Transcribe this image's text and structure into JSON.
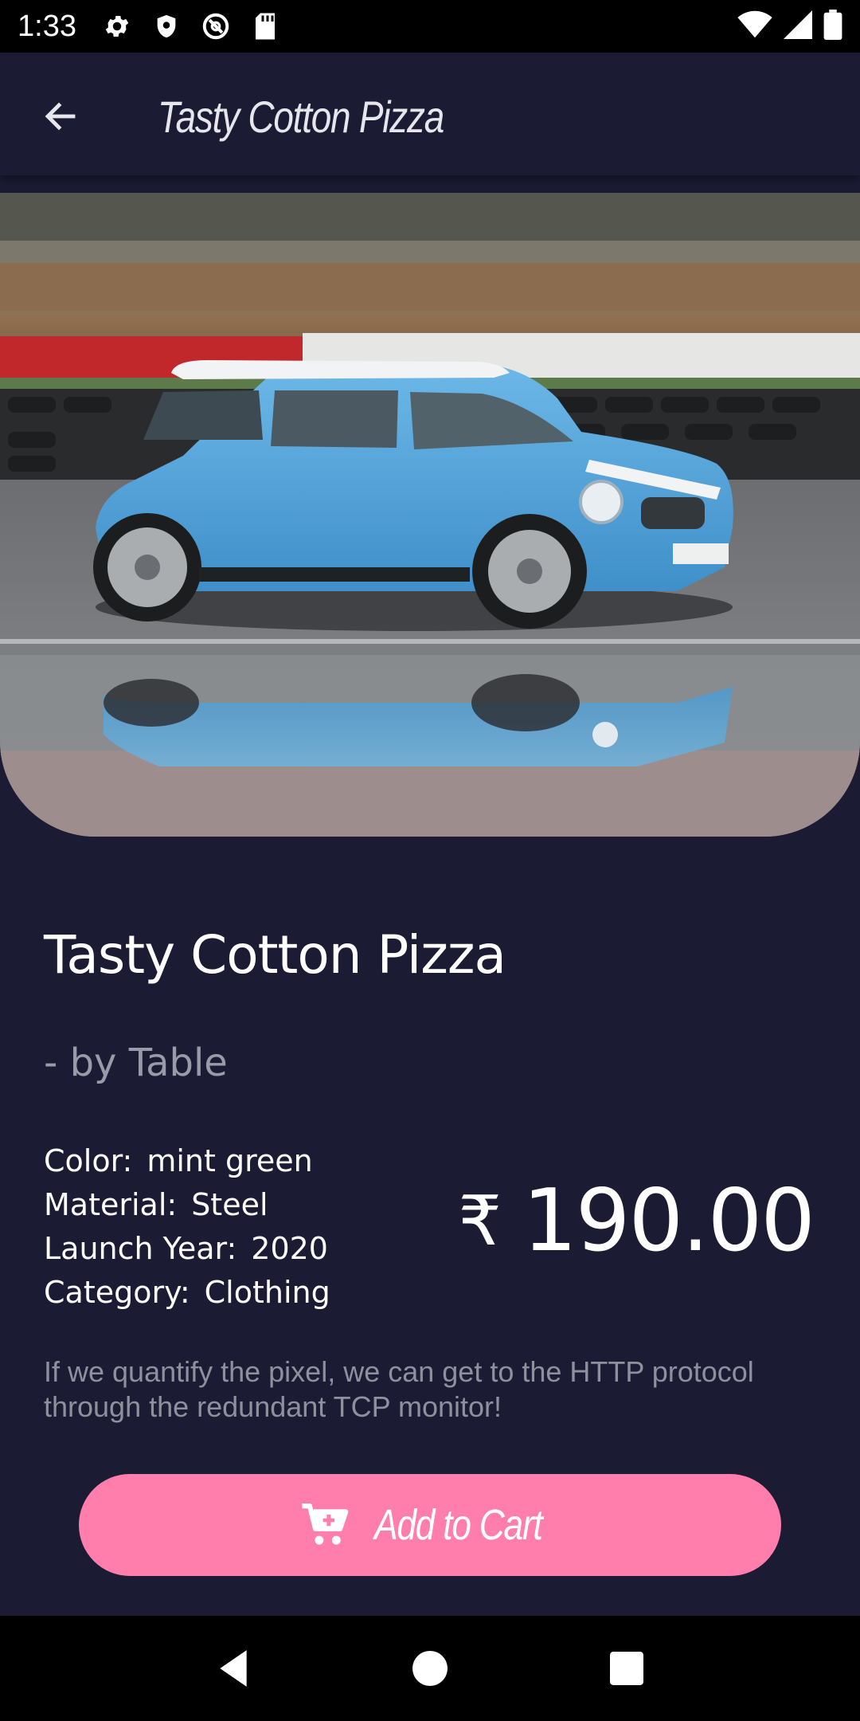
{
  "status_bar": {
    "time": "1:33",
    "left_icons": [
      "gear-icon",
      "shield-icon",
      "at-sign-icon",
      "sd-card-icon"
    ],
    "right_icons": [
      "wifi-icon",
      "signal-icon",
      "battery-icon"
    ]
  },
  "app_bar": {
    "back_icon": "arrow-back-icon",
    "title": "Tasty Cotton Pizza"
  },
  "product": {
    "image_alt": "Blue Mini Cooper on wet race track",
    "name": "Tasty Cotton Pizza",
    "brand": "- by Table",
    "specs": [
      {
        "key": "Color:",
        "value": "mint green"
      },
      {
        "key": "Material:",
        "value": "Steel"
      },
      {
        "key": "Launch Year:",
        "value": "2020"
      },
      {
        "key": "Category:",
        "value": "Clothing"
      }
    ],
    "currency_symbol": "₹",
    "price": "190.00",
    "description": "If we quantify the pixel, we can get to the HTTP protocol through the redundant TCP monitor!"
  },
  "cart_button": {
    "icon": "cart-plus-icon",
    "label": "Add to Cart"
  },
  "nav_bar": {
    "icons": [
      "back-triangle-icon",
      "home-circle-icon",
      "recents-square-icon"
    ]
  },
  "colors": {
    "background": "#1b1c33",
    "accent": "#ff7eab",
    "muted_text": "#9a9aa8"
  }
}
